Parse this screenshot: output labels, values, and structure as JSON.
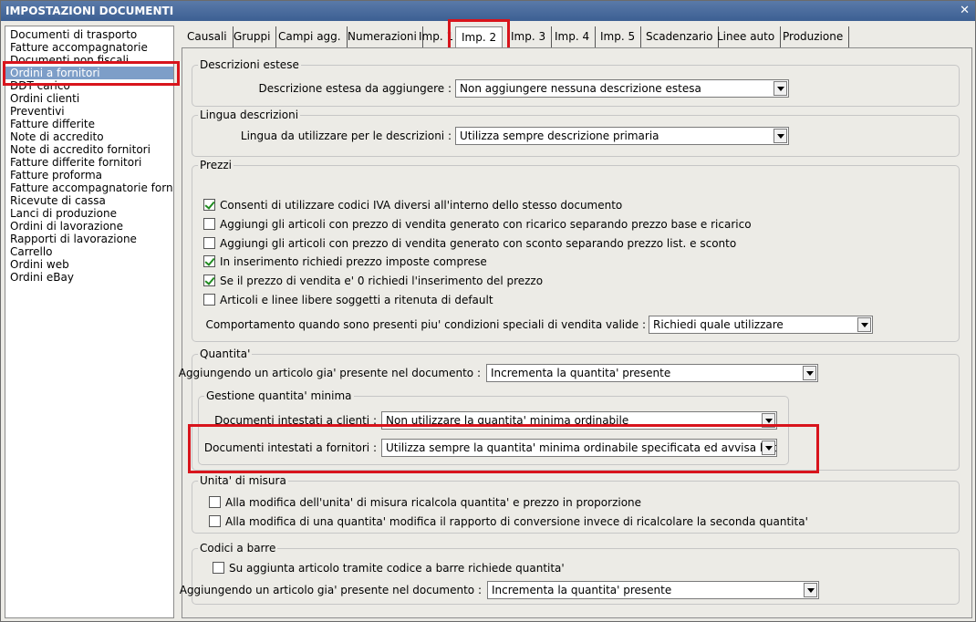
{
  "window": {
    "title": "IMPOSTAZIONI DOCUMENTI",
    "close_label": "✕"
  },
  "sidebar": {
    "items": [
      "Documenti di trasporto",
      "Fatture accompagnatorie",
      "Documenti non fiscali",
      "Ordini a fornitori",
      "DDT carico",
      "Ordini clienti",
      "Preventivi",
      "Fatture differite",
      "Note di accredito",
      "Note di accredito fornitori",
      "Fatture differite fornitori",
      "Fatture proforma",
      "Fatture accompagnatorie fornitori",
      "Ricevute di cassa",
      "Lanci di produzione",
      "Ordini di lavorazione",
      "Rapporti di lavorazione",
      "Carrello",
      "Ordini web",
      "Ordini eBay"
    ],
    "selected_index": 3
  },
  "tabs": [
    "Causali",
    "Gruppi",
    "Campi agg.",
    "Numerazioni",
    "Imp. 1",
    "Imp. 2",
    "Imp. 3",
    "Imp. 4",
    "Imp. 5",
    "Scadenzario",
    "Linee auto",
    "Produzione"
  ],
  "active_tab": "Imp. 2",
  "descrizioni": {
    "title": "Descrizioni estese",
    "label": "Descrizione estesa da aggiungere :",
    "value": "Non aggiungere nessuna descrizione estesa"
  },
  "lingua": {
    "title": "Lingua descrizioni",
    "label": "Lingua da utilizzare per le descrizioni :",
    "value": "Utilizza sempre descrizione primaria"
  },
  "prezzi": {
    "title": "Prezzi",
    "checks": [
      {
        "label": "Consenti di utilizzare codici IVA diversi all'interno dello stesso documento",
        "checked": true
      },
      {
        "label": "Aggiungi gli articoli con prezzo di vendita generato con ricarico separando prezzo base e ricarico",
        "checked": false
      },
      {
        "label": "Aggiungi gli articoli con prezzo di vendita generato con sconto separando prezzo list. e sconto",
        "checked": false
      },
      {
        "label": "In inserimento richiedi prezzo imposte comprese",
        "checked": true
      },
      {
        "label": "Se il prezzo di vendita e' 0 richiedi l'inserimento del prezzo",
        "checked": true
      },
      {
        "label": "Articoli e linee libere soggetti a ritenuta di default",
        "checked": false
      }
    ],
    "comportamento_label": "Comportamento quando sono presenti piu' condizioni speciali di vendita valide :",
    "comportamento_value": "Richiedi quale utilizzare"
  },
  "quantita": {
    "title": "Quantita'",
    "aggiungendo_label": "Aggiungendo un articolo gia' presente nel documento :",
    "aggiungendo_value": "Incrementa la quantita' presente",
    "minima": {
      "title": "Gestione quantita' minima",
      "clienti_label": "Documenti intestati a clienti :",
      "clienti_value": "Non utilizzare la quantita' minima ordinabile",
      "fornitori_label": "Documenti intestati a fornitori :",
      "fornitori_value": "Utilizza sempre la quantita' minima ordinabile specificata ed avvisa l'utente"
    }
  },
  "unita": {
    "title": "Unita' di misura",
    "checks": [
      {
        "label": "Alla modifica dell'unita' di misura ricalcola quantita' e prezzo in proporzione",
        "checked": false
      },
      {
        "label": "Alla modifica di una quantita' modifica il rapporto di conversione invece di ricalcolare la seconda quantita'",
        "checked": false
      }
    ]
  },
  "codici": {
    "title": "Codici a barre",
    "check": {
      "label": "Su aggiunta articolo tramite codice a barre richiede quantita'",
      "checked": false
    },
    "aggiungendo_label": "Aggiungendo un articolo gia' presente nel documento :",
    "aggiungendo_value": "Incrementa la quantita' presente"
  }
}
